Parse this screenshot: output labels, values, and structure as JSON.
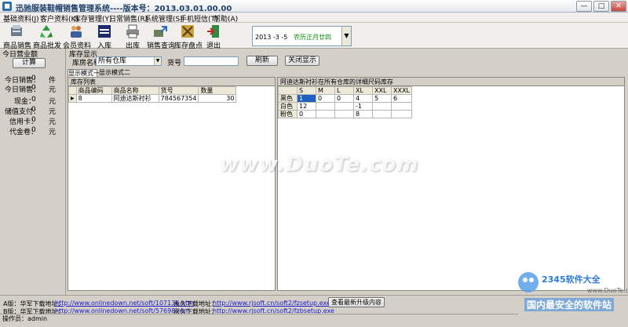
{
  "window": {
    "title": "迅驰服装鞋帽销售管理系统----版本号：2013.03.01.00.00",
    "minimize_glyph": "—",
    "maximize_glyph": "□",
    "close_glyph": "✕"
  },
  "menu": [
    "基础资料(J)",
    "客户资料(K)",
    "库存管理(Y)",
    "日常销售(R)",
    "系统管理(S)",
    "手机短信(T)",
    "帮助(A)"
  ],
  "toolbar": {
    "items": [
      {
        "label": "商品销售",
        "icon": "cashier-icon"
      },
      {
        "label": "商品批发",
        "icon": "recycle-icon"
      },
      {
        "label": "会员资料",
        "icon": "members-icon"
      },
      {
        "label": "入库",
        "icon": "note-icon"
      },
      {
        "label": "出库",
        "icon": "printer-icon"
      },
      {
        "label": "销售查询",
        "icon": "query-icon"
      },
      {
        "label": "库存盘点",
        "icon": "inventory-icon"
      },
      {
        "label": "退出",
        "icon": "exit-icon"
      }
    ],
    "date": "2013 -3  -5",
    "weekday": "农历正月廿四",
    "date_arrow": "▼"
  },
  "left_panel": {
    "title": "今日营业额",
    "calc_button": "计算",
    "rows": [
      {
        "label": "今日销售：",
        "value": "0",
        "unit": "件"
      },
      {
        "label": "今日销售：",
        "value": "0",
        "unit": "元"
      },
      {
        "label": "现金：",
        "value": "0",
        "unit": "元"
      },
      {
        "label": "储值支付：",
        "value": "0",
        "unit": "元"
      },
      {
        "label": "信用卡：",
        "value": "0",
        "unit": "元"
      },
      {
        "label": "代金卷：",
        "value": "0",
        "unit": "元"
      }
    ]
  },
  "stock": {
    "section_title": "库存显示",
    "warehouse_label": "库房名称",
    "warehouse_value": "所有仓库",
    "warehouse_arrow": "▼",
    "code_label": "货号",
    "code_value": "",
    "refresh_button": "刷新",
    "close_button": "关闭显示",
    "tabs": [
      "显示模式一",
      "显示模式二"
    ],
    "list": {
      "title": "库存列表",
      "headers": [
        "商品编码",
        "商品名称",
        "货号",
        "数量"
      ],
      "rows": [
        {
          "marker": "▶",
          "code": "8",
          "name": "阿迪达斯衬衫",
          "sku": "784567354",
          "qty": "30"
        }
      ]
    },
    "detail": {
      "title": "阿迪达斯衬衫在所有仓库的详细尺码库存",
      "sizes": [
        "S",
        "M",
        "L",
        "XL",
        "XXL",
        "XXXL"
      ],
      "rows": [
        {
          "color": "黑色",
          "values": [
            "1",
            "0",
            "0",
            "4",
            "5",
            "6"
          ]
        },
        {
          "color": "白色",
          "values": [
            "12",
            "",
            "",
            "-1",
            "",
            ""
          ]
        },
        {
          "color": "粉色",
          "values": [
            "0",
            "",
            "",
            "8",
            "",
            ""
          ]
        }
      ]
    }
  },
  "bottom": {
    "a_label": "A版：华军下载地址：",
    "a_link": "http://www.onlinedown.net/soft/107136.htm",
    "a_perm_label": "永久下载地址：",
    "a_perm_link": "http://www.rjsoft.cn/soft2/fzsetup.exe",
    "b_label": "B版：华军下载地址：",
    "b_link": "http://www.onlinedown.net/soft/57698.htm",
    "b_perm_label": "永久下载地址：",
    "b_perm_link": "http://www.rjsoft.cn/soft2/fzbsetup.exe",
    "upgrade_button": "查看最新升级内容",
    "status": "操作员：admin"
  },
  "watermarks": {
    "center": "www.DuoTe.com",
    "logo_title": "2345软件大全",
    "logo_site": "www.DuoTe.com",
    "logo_slogan": "国内最安全的软件站"
  }
}
